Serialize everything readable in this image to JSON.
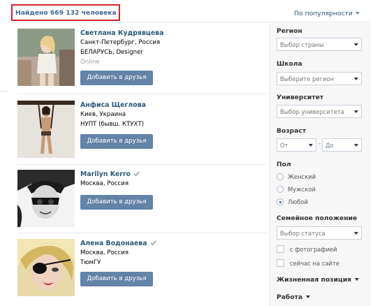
{
  "header": {
    "results_count": "Найдено 669 132 человека",
    "sort_label": "По популярности"
  },
  "people": [
    {
      "name": "Светлана Кудрявцева",
      "location": "Санкт-Петербург, Россия",
      "extra": "БЕЛАРУСЬ, Designer",
      "status": "Online",
      "verified": false,
      "add_label": "Добавить в друзья"
    },
    {
      "name": "Анфиса Щеглова",
      "location": "Киев, Украина",
      "extra": "НУПТ (бывш. КТУХТ)",
      "status": "",
      "verified": false,
      "add_label": "Добавить в друзья"
    },
    {
      "name": "Marilyn Kerro",
      "location": "Москва, Россия",
      "extra": "",
      "status": "",
      "verified": true,
      "add_label": "Добавить в друзья"
    },
    {
      "name": "Алена Водонаева",
      "location": "Москва, Россия",
      "extra": "ТюмГУ",
      "status": "",
      "verified": true,
      "add_label": "Добавить в друзья"
    }
  ],
  "filters": {
    "region_label": "Регион",
    "region_placeholder": "Выбор страны",
    "school_label": "Школа",
    "school_placeholder": "Выберите регион",
    "university_label": "Университет",
    "university_placeholder": "Выбор университета",
    "age_label": "Возраст",
    "age_from": "От",
    "age_to": "До",
    "age_dash": "-",
    "gender_label": "Пол",
    "gender_options": [
      "Женский",
      "Мужской",
      "Любой"
    ],
    "gender_selected": "Любой",
    "marital_label": "Семейное положение",
    "marital_placeholder": "Выбор статуса",
    "with_photo": "с фотографией",
    "online_now": "сейчас на сайте",
    "life_position": "Жизненная позиция",
    "work": "Работа"
  },
  "colors": {
    "accent_blue": "#45688e",
    "name_blue": "#2b587a",
    "button_blue": "#6383a8",
    "highlight_red": "#d2232a",
    "sidebar_bg": "#f7f7f7"
  }
}
